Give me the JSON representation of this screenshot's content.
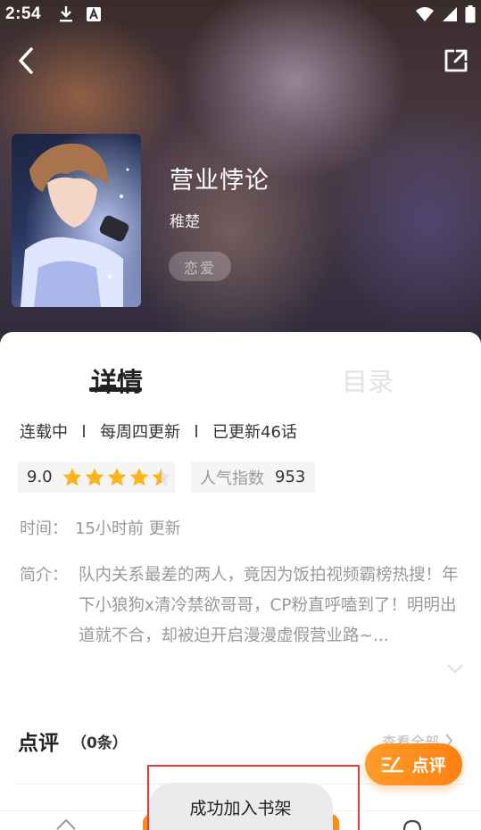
{
  "status_bar": {
    "time": "2:54"
  },
  "book": {
    "title": "营业悖论",
    "author": "稚楚",
    "genre": "恋爱"
  },
  "tabs": {
    "detail": "详情",
    "catalog": "目录"
  },
  "meta": {
    "status": "连载中",
    "schedule": "每周四更新",
    "episodes": "已更新46话"
  },
  "rating": {
    "score": "9.0",
    "stars": 4.5
  },
  "popularity": {
    "label": "人气指数",
    "value": "953"
  },
  "update": {
    "label": "时间：",
    "value": "15小时前 更新"
  },
  "intro": {
    "label": "简介：",
    "text": "队内关系最差的两人，竟因为饭拍视频霸榜热搜！年下小狼狗x清冷禁欲哥哥，CP粉直呼嗑到了！明明出道就不合，却被迫开启漫漫虚假营业路~..."
  },
  "reviews": {
    "title": "点评",
    "count": "（0条）",
    "view_all": "查看全部",
    "button": "点评"
  },
  "toast": {
    "message": "成功加入书架"
  },
  "colors": {
    "accent": "#ff8a18",
    "star": "#ffb31a",
    "highlight": "#e53935"
  }
}
